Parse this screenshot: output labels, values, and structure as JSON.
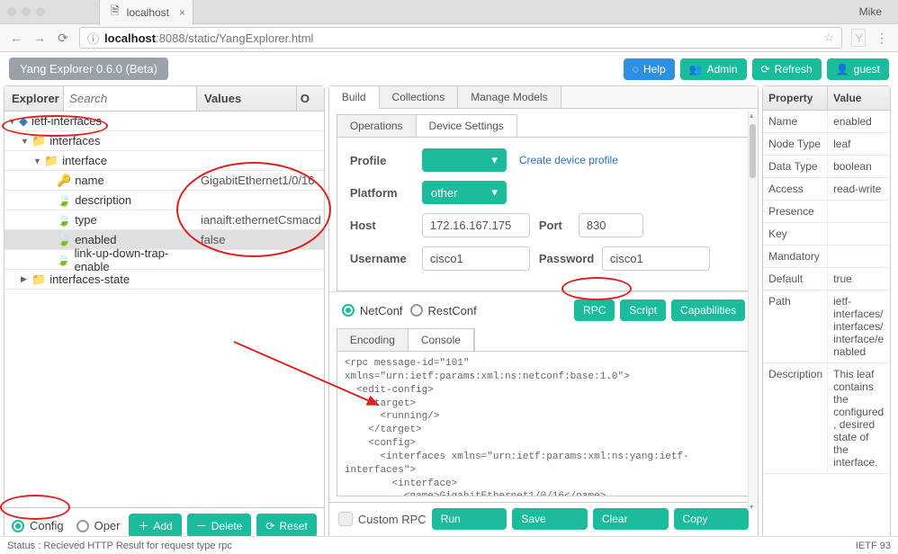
{
  "browser": {
    "tab_title": "localhost",
    "user": "Mike",
    "url_host": "localhost",
    "url_rest": ":8088/static/YangExplorer.html"
  },
  "app": {
    "title": "Yang Explorer 0.6.0 (Beta)",
    "buttons": {
      "help": "Help",
      "admin": "Admin",
      "refresh": "Refresh",
      "guest": "guest"
    }
  },
  "explorer": {
    "header": {
      "title": "Explorer",
      "search_placeholder": "Search",
      "values": "Values",
      "op": "O"
    },
    "rows": [
      {
        "name": "ietf-interfaces",
        "value": "",
        "indent": 0,
        "icon": "module",
        "expand": "open"
      },
      {
        "name": "interfaces",
        "value": "",
        "indent": 1,
        "icon": "folder",
        "expand": "open"
      },
      {
        "name": "interface",
        "value": "",
        "indent": 2,
        "icon": "folder",
        "expand": "open"
      },
      {
        "name": "name",
        "value": "GigabitEthernet1/0/16",
        "indent": 3,
        "icon": "key"
      },
      {
        "name": "description",
        "value": "",
        "indent": 3,
        "icon": "leaf"
      },
      {
        "name": "type",
        "value": "ianaift:ethernetCsmacd",
        "indent": 3,
        "icon": "leaf"
      },
      {
        "name": "enabled",
        "value": "false",
        "indent": 3,
        "icon": "leaf",
        "selected": true
      },
      {
        "name": "link-up-down-trap-enable",
        "value": "",
        "indent": 3,
        "icon": "leaf"
      },
      {
        "name": "interfaces-state",
        "value": "",
        "indent": 1,
        "icon": "folder",
        "expand": "closed"
      }
    ],
    "footer": {
      "config": "Config",
      "oper": "Oper",
      "add": "Add",
      "delete": "Delete",
      "reset": "Reset"
    }
  },
  "center": {
    "tabs": {
      "build": "Build",
      "collections": "Collections",
      "manage": "Manage Models"
    },
    "subtabs": {
      "operations": "Operations",
      "device": "Device Settings"
    },
    "form": {
      "profile_label": "Profile",
      "profile_value": "",
      "create_link": "Create device profile",
      "platform_label": "Platform",
      "platform_value": "other",
      "host_label": "Host",
      "host_value": "172.16.167.175",
      "port_label": "Port",
      "port_value": "830",
      "user_label": "Username",
      "user_value": "cisco1",
      "pass_label": "Password",
      "pass_value": "cisco1"
    },
    "proto": {
      "netconf": "NetConf",
      "restconf": "RestConf",
      "rpc": "RPC",
      "script": "Script",
      "caps": "Capabilities"
    },
    "console_tabs": {
      "encoding": "Encoding",
      "console": "Console"
    },
    "console_text": "<rpc message-id=\"101\"\nxmlns=\"urn:ietf:params:xml:ns:netconf:base:1.0\">\n  <edit-config>\n    <target>\n      <running/>\n    </target>\n    <config>\n      <interfaces xmlns=\"urn:ietf:params:xml:ns:yang:ietf-\ninterfaces\">\n        <interface>\n          <name>GigabitEthernet1/0/16</name>\n          <type xmlns:ianaift=\"urn:ietf:params:xml:ns:yang:iana-if-\ntype\">ianaift:ethernetCsmacd</type>\n          <enabled>false</enabled>\n        </interface>",
    "runbar": {
      "custom": "Custom RPC",
      "run": "Run",
      "save": "Save",
      "clear": "Clear",
      "copy": "Copy"
    }
  },
  "props": {
    "header": {
      "prop": "Property",
      "val": "Value"
    },
    "rows": [
      {
        "k": "Name",
        "v": "enabled"
      },
      {
        "k": "Node Type",
        "v": "leaf"
      },
      {
        "k": "Data Type",
        "v": "boolean"
      },
      {
        "k": "Access",
        "v": "read-write"
      },
      {
        "k": "Presence",
        "v": ""
      },
      {
        "k": "Key",
        "v": ""
      },
      {
        "k": "Mandatory",
        "v": ""
      },
      {
        "k": "Default",
        "v": "true"
      },
      {
        "k": "Path",
        "v": "ietf-interfaces/interfaces/interface/enabled"
      },
      {
        "k": "Description",
        "v": "This leaf contains the configured, desired state of the interface."
      }
    ]
  },
  "status": {
    "left": "Status : Recieved HTTP Result for request type rpc",
    "right": "IETF 93"
  }
}
